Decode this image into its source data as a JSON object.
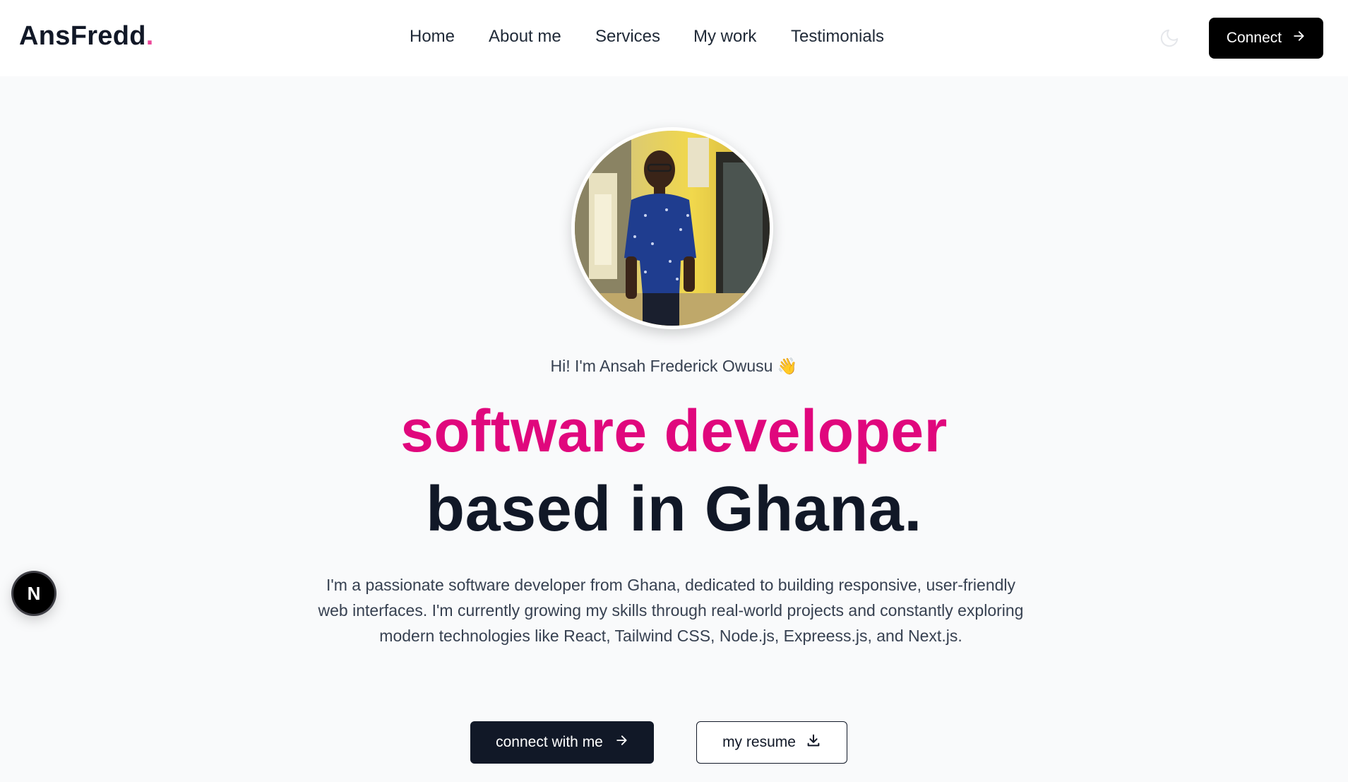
{
  "brand": {
    "name": "AnsFredd",
    "dot": ".",
    "accent_color": "#ec4899"
  },
  "nav": {
    "items": [
      {
        "label": "Home"
      },
      {
        "label": "About me"
      },
      {
        "label": "Services"
      },
      {
        "label": "My work"
      },
      {
        "label": "Testimonials"
      }
    ],
    "theme_icon": "moon-icon",
    "connect_label": "Connect",
    "connect_icon": "arrow-right-icon"
  },
  "hero": {
    "greeting": "Hi! I'm Ansah Frederick Owusu",
    "greeting_emoji": "wave-hand-icon",
    "headline_highlight": "software developer",
    "headline_rest": "based in Ghana.",
    "highlight_color": "#e0077d",
    "bio": "I'm a passionate software developer from Ghana, dedicated to building responsive, user-friendly web interfaces. I'm currently growing my skills through real-world projects and constantly exploring modern technologies like React, Tailwind CSS, Node.js, Expreess.js, and Next.js.",
    "primary_cta": "connect with me",
    "secondary_cta": "my resume",
    "primary_icon": "arrow-right-icon",
    "secondary_icon": "download-icon"
  },
  "dev_badge": {
    "letter": "N",
    "icon": "nextjs-logo-icon"
  }
}
